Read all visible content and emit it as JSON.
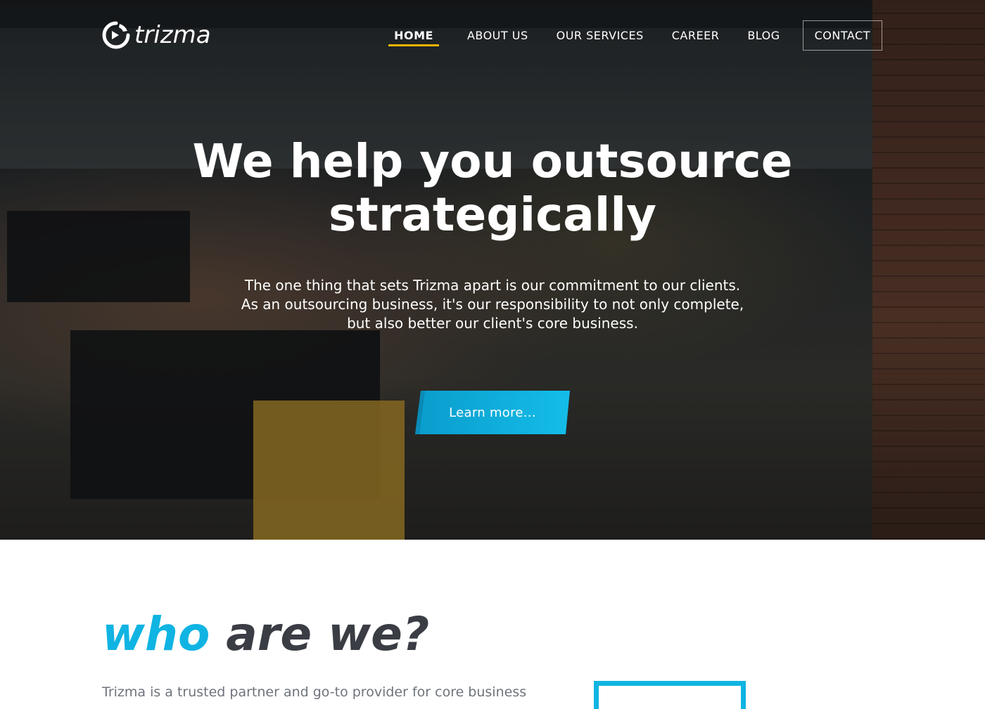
{
  "brand": {
    "name": "trizma",
    "logo_icon": "trizma-circle-logo-icon",
    "accent_color": "#10b4e2",
    "active_color": "#f5b400"
  },
  "nav": {
    "items": [
      {
        "label": "HOME",
        "active": true
      },
      {
        "label": "ABOUT US",
        "active": false
      },
      {
        "label": "OUR SERVICES",
        "active": false
      },
      {
        "label": "CAREER",
        "active": false
      },
      {
        "label": "BLOG",
        "active": false
      },
      {
        "label": "CONTACT",
        "active": false
      }
    ]
  },
  "hero": {
    "title": "We help you outsource strategically",
    "text": "The one thing that sets Trizma apart is our commitment to our clients. As an outsourcing business, it's our responsibility to not only complete, but also better our client's core business.",
    "cta_label": "Learn more..."
  },
  "who": {
    "heading_accent": "who",
    "heading_rest": "are we?",
    "text": "Trizma is a trusted partner and go-to provider for core business"
  }
}
